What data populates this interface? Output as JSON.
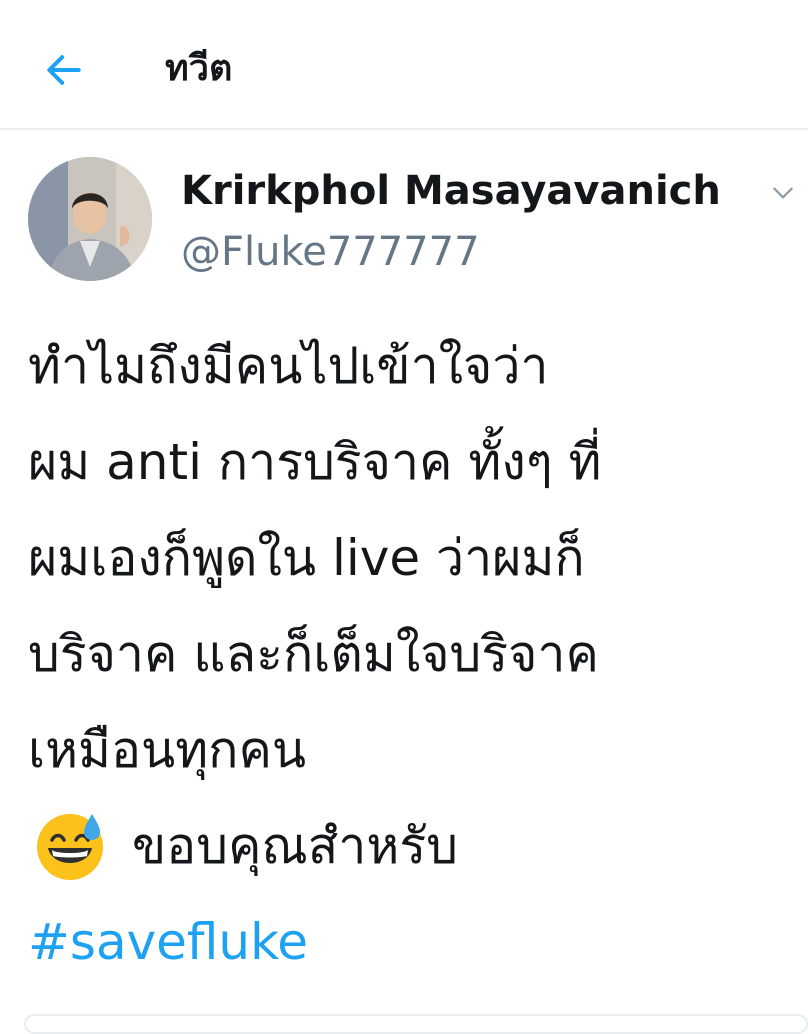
{
  "header": {
    "title": "ทวีต",
    "back_icon": "arrow-left-icon"
  },
  "tweet": {
    "author_name": "Krirkphol Masayavanich",
    "author_handle": "@Fluke777777",
    "more_icon": "chevron-down-icon",
    "lines": [
      "ทำไมถึงมีคนไปเข้าใจว่า",
      "ผม anti การบริจาค ทั้งๆ ที่",
      "ผมเองก็พูดใน live ว่าผมก็",
      "บริจาค และก็เต็มใจบริจาค",
      "เหมือนทุกคน"
    ],
    "emoji_icon": "grinning-face-with-sweat-icon",
    "emoji_line_text": "ขอบคุณสำหรับ",
    "hashtag": "#savefluke"
  },
  "colors": {
    "accent": "#1da1f2",
    "text_primary": "#14171a",
    "text_secondary": "#657786",
    "divider": "#e6ecf0"
  }
}
